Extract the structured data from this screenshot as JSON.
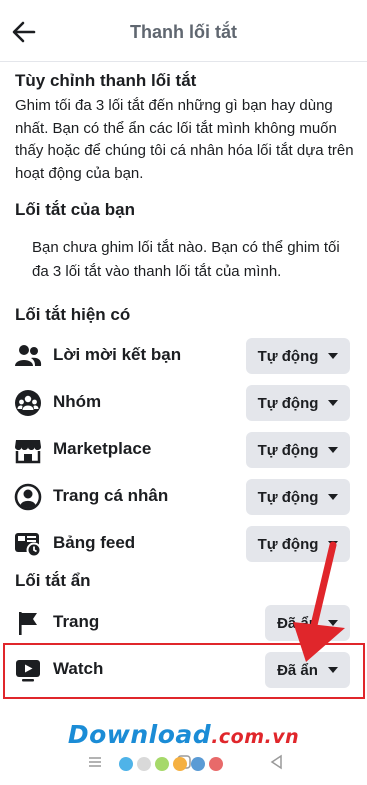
{
  "header": {
    "title": "Thanh lối tắt"
  },
  "customize": {
    "title": "Tùy chỉnh thanh lối tắt",
    "description": "Ghim tối đa 3 lối tắt đến những gì bạn hay dùng nhất. Bạn có thể ẩn các lối tắt mình không muốn thấy hoặc để chúng tôi cá nhân hóa lối tắt dựa trên hoạt động của bạn."
  },
  "your_shortcuts": {
    "title": "Lối tắt của bạn",
    "empty_text": "Bạn chưa ghim lối tắt nào. Bạn có thể ghim tối đa 3 lối tắt vào thanh lối tắt của mình."
  },
  "available": {
    "title": "Lối tắt hiện có",
    "items": [
      {
        "label": "Lời mời kết bạn",
        "setting": "Tự động",
        "icon": "friends-icon"
      },
      {
        "label": "Nhóm",
        "setting": "Tự động",
        "icon": "groups-icon"
      },
      {
        "label": "Marketplace",
        "setting": "Tự động",
        "icon": "marketplace-icon"
      },
      {
        "label": "Trang cá nhân",
        "setting": "Tự động",
        "icon": "profile-icon"
      },
      {
        "label": "Bảng feed",
        "setting": "Tự động",
        "icon": "feed-icon"
      }
    ]
  },
  "hidden": {
    "title": "Lối tắt ẩn",
    "items": [
      {
        "label": "Trang",
        "setting": "Đã ẩn",
        "icon": "flag-icon"
      },
      {
        "label": "Watch",
        "setting": "Đã ẩn",
        "icon": "watch-icon"
      }
    ]
  },
  "watermark": {
    "brand": "Download",
    "suffix": ".com.vn",
    "dot_colors": [
      "#4fb3e8",
      "#d9d9d9",
      "#a6d96a",
      "#f5b041",
      "#5a9bd5",
      "#e86a6a"
    ]
  },
  "colors": {
    "button_bg": "#e4e6eb",
    "highlight": "#e0262b",
    "text": "#1c1e21",
    "muted": "#606770"
  }
}
